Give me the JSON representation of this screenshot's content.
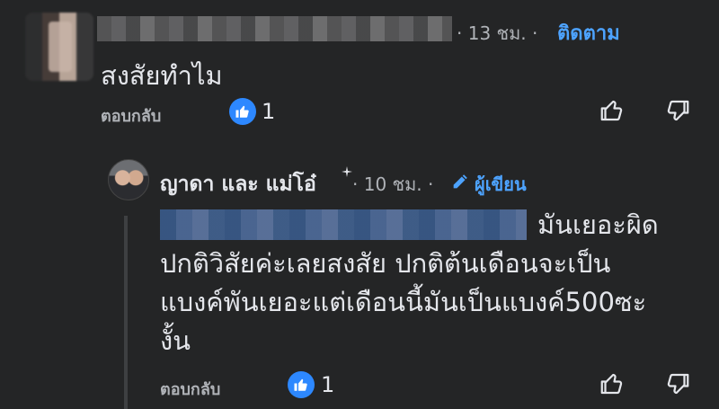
{
  "top_comment": {
    "time": "· 13 ชม. ·",
    "follow_label": "ติดตาม",
    "text": "สงสัยทำไม",
    "reply_label": "ตอบกลับ",
    "like_count": "1"
  },
  "reply_comment": {
    "author_name": "ญาดา และ แม่โอ๋",
    "time": "· 10 ชม. ·",
    "author_badge": "ผู้เขียน",
    "text_line1_tail": "มันเยอะผิด",
    "text_line2": "ปกติวิสัยค่ะเลยสงสัย ปกติต้นเดือนจะเป็น",
    "text_line3": "แบงค์พันเยอะแต่เดือนนี้มันเป็นแบงค์500ซะ",
    "text_line4": "งั้น",
    "reply_label": "ตอบกลับ",
    "like_count": "1"
  },
  "colors": {
    "background": "#242526",
    "accent": "#4da3ff",
    "like_badge": "#2d88ff",
    "text": "#e4e6eb",
    "muted": "#b0b3b8"
  },
  "icons": [
    "like-icon",
    "thumb-up-icon",
    "thumb-down-icon",
    "pencil-icon",
    "sparkle-icon"
  ]
}
